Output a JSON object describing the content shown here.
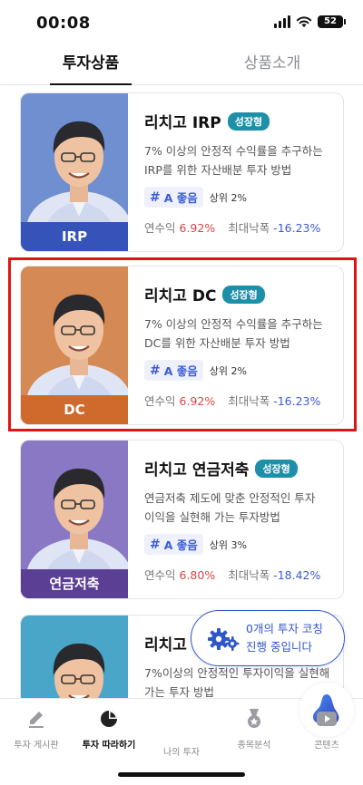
{
  "status": {
    "time": "00:08",
    "battery": "52"
  },
  "tabs": [
    {
      "label": "투자상품"
    },
    {
      "label": "상품소개"
    }
  ],
  "products": [
    {
      "title": "리치고 IRP",
      "badge": "성장형",
      "description": "7% 이상의 안정적 수익률을 추구하는 IRP를 위한 자산배분 투자 방법",
      "grade": "A 좋음",
      "rank": "상위 2%",
      "return_label": "연수익",
      "return_value": "6.92%",
      "drawdown_label": "최대낙폭",
      "drawdown_value": "-16.23%",
      "photo_label": "IRP",
      "photo_bg": "#6f8fd1",
      "label_bg": "#3553b8"
    },
    {
      "title": "리치고 DC",
      "badge": "성장형",
      "description": "7% 이상의 안정적 수익률을 추구하는 DC를 위한 자산배분 투자 방법",
      "grade": "A 좋음",
      "rank": "상위 2%",
      "return_label": "연수익",
      "return_value": "6.92%",
      "drawdown_label": "최대낙폭",
      "drawdown_value": "-16.23%",
      "photo_label": "DC",
      "photo_bg": "#d58a55",
      "label_bg": "#d06a2c"
    },
    {
      "title": "리치고 연금저축",
      "badge": "성장형",
      "description": "연금저축 제도에 맞춘 안정적인 투자 이익을 실현해 가는 투자방법",
      "grade": "A 좋음",
      "rank": "상위 3%",
      "return_label": "연수익",
      "return_value": "6.80%",
      "drawdown_label": "최대낙폭",
      "drawdown_value": "-18.42%",
      "photo_label": "연금저축",
      "photo_bg": "#8a78c4",
      "label_bg": "#5b3f94"
    },
    {
      "title": "리치고",
      "badge": "",
      "description": "7%이상의 안정적인 투자이익을 실현해 가는 투자 방법",
      "grade": "",
      "rank": "",
      "return_label": "",
      "return_value": "",
      "drawdown_label": "",
      "drawdown_value": "",
      "photo_label": "",
      "photo_bg": "#4aa6c8",
      "label_bg": "#1e7fa6"
    }
  ],
  "coach": {
    "line1": "0개의 투자 코칭",
    "line2": "진행 중입니다"
  },
  "nav": [
    {
      "label": "투자 게시판",
      "icon": "pencil-icon"
    },
    {
      "label": "투자 따라하기",
      "icon": "pie-chart-icon"
    },
    {
      "label": "나의 투자",
      "icon": "blob-icon"
    },
    {
      "label": "종목분석",
      "icon": "medal-icon"
    },
    {
      "label": "콘텐츠",
      "icon": "play-icon"
    }
  ],
  "colors": {
    "accent": "#2f56c9",
    "badge": "#1e8fa8",
    "return": "#d64545",
    "drawdown": "#3b5bd6",
    "highlight": "#e01414"
  }
}
